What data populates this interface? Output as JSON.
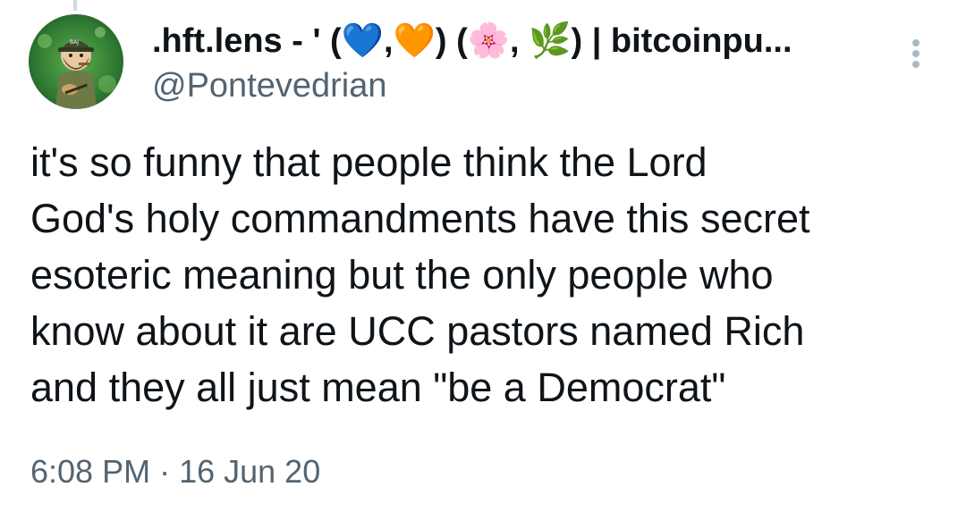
{
  "author": {
    "display_name": ".hft.lens - ' (💙,🧡) (🌸, 🌿) | bitcoinpu...",
    "handle": "@Pontevedrian",
    "avatar_icon": "avatar-cartoon-figure-icon"
  },
  "tweet": {
    "text": "it's so funny that people think the Lord\nGod's holy commandments have this secret\nesoteric meaning but the only people who\nknow about it are UCC pastors named Rich\nand they all just mean \"be a Democrat\""
  },
  "meta": {
    "time": "6:08 PM",
    "separator": " · ",
    "date": "16 Jun 20"
  },
  "icons": {
    "more": "more-options-icon"
  },
  "colors": {
    "text_primary": "#0f1419",
    "text_secondary": "#536471",
    "avatar_bg": "#3f8a3a"
  }
}
